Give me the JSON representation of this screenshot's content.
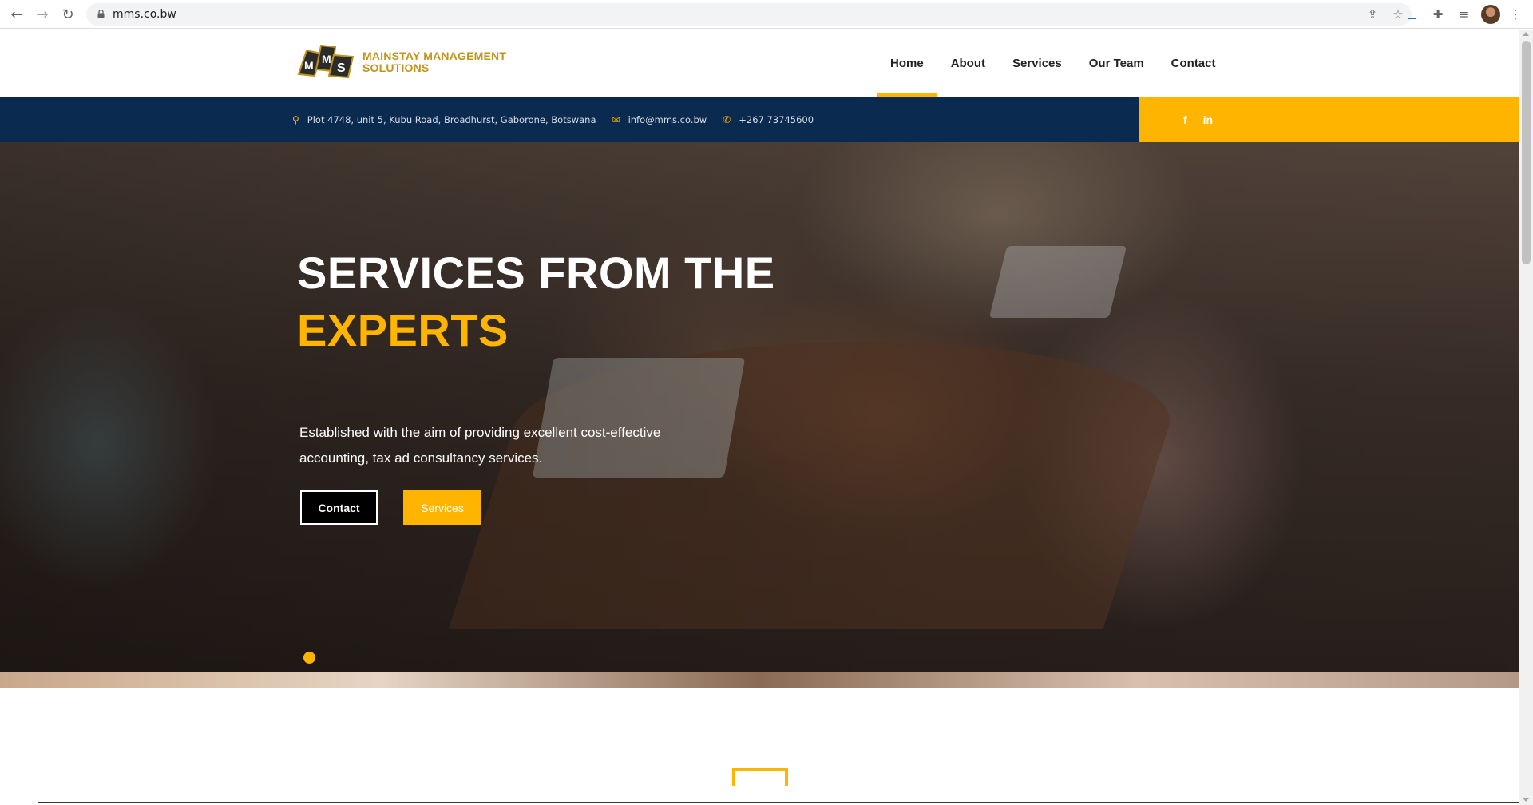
{
  "browser": {
    "url": "mms.co.bw",
    "icons": [
      "back-icon",
      "forward-icon",
      "reload-icon",
      "lock-icon",
      "share-icon",
      "star-icon",
      "download-icon",
      "extensions-icon",
      "reading-list-icon",
      "profile-avatar",
      "more-menu-icon"
    ]
  },
  "site": {
    "logo": {
      "mark_letters": [
        "M",
        "M",
        "S"
      ],
      "line1": "MAINSTAY MANAGEMENT",
      "line2": "SOLUTIONS"
    },
    "nav": {
      "items": [
        {
          "label": "Home",
          "active": true
        },
        {
          "label": "About",
          "active": false
        },
        {
          "label": "Services",
          "active": false
        },
        {
          "label": "Our Team",
          "active": false
        },
        {
          "label": "Contact",
          "active": false
        }
      ]
    },
    "info_bar": {
      "address": "Plot 4748, unit 5, Kubu Road, Broadhurst, Gaborone, Botswana",
      "email": "info@mms.co.bw",
      "phone": "+267 73745600",
      "social": [
        "f",
        "in"
      ]
    },
    "hero": {
      "title_line1": "SERVICES FROM THE",
      "title_line2": "EXPERTS",
      "description": "Established with the aim of providing excellent cost-effective accounting, tax ad consultancy services.",
      "button_contact": "Contact",
      "button_services": "Services"
    }
  },
  "colors": {
    "accent": "#ffb400",
    "navy": "#0b2a50",
    "logo_gold": "#c0951d"
  }
}
